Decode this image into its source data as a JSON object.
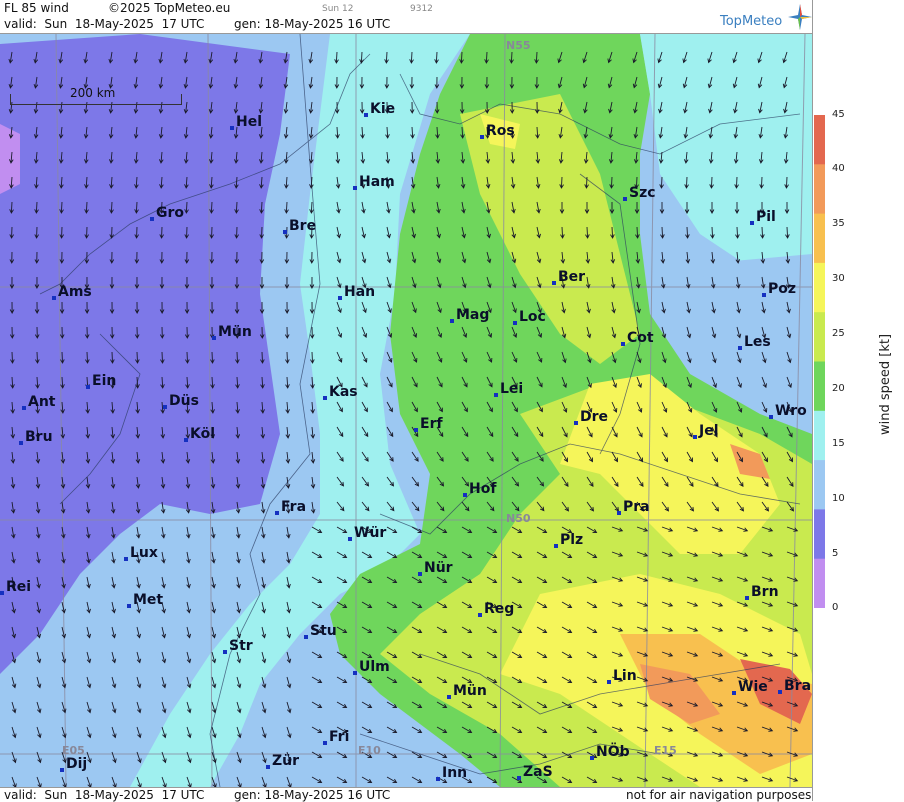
{
  "header": {
    "product": "FL 85 wind",
    "copyright": "©2025 TopMeteo.eu",
    "run_small": "Sun 12",
    "id_small": "9312",
    "valid": "valid:  Sun  18-May-2025  17 UTC",
    "gen": "gen: 18-May-2025 16 UTC",
    "logo_text": "TopMeteo"
  },
  "footer": {
    "valid": "valid:  Sun  18-May-2025  17 UTC",
    "gen": "gen: 18-May-2025 16 UTC",
    "disclaimer": "not for air navigation purposes"
  },
  "scale": {
    "label": "200 km"
  },
  "legend": {
    "title": "wind speed  [kt]",
    "ticks": [
      "45",
      "40",
      "35",
      "30",
      "25",
      "20",
      "15",
      "10",
      "5",
      "0"
    ],
    "colors": [
      "#e3684f",
      "#f29a5a",
      "#f8c04f",
      "#f5f55a",
      "#c9ea4f",
      "#6fd65c",
      "#9ff0ef",
      "#9cc8f2",
      "#7d78e8",
      "#c18ef0"
    ]
  },
  "grid_labels": [
    "N55",
    "N50",
    "E05",
    "E10",
    "E15"
  ],
  "cities": [
    {
      "name": "Kie"
    },
    {
      "name": "Hel"
    },
    {
      "name": "Ros"
    },
    {
      "name": "Ham"
    },
    {
      "name": "Szc"
    },
    {
      "name": "Gro"
    },
    {
      "name": "Bre"
    },
    {
      "name": "Pil"
    },
    {
      "name": "Ber"
    },
    {
      "name": "Ams"
    },
    {
      "name": "Han"
    },
    {
      "name": "Poz"
    },
    {
      "name": "Mag"
    },
    {
      "name": "Loc"
    },
    {
      "name": "Mün"
    },
    {
      "name": "Cot"
    },
    {
      "name": "Les"
    },
    {
      "name": "Ein"
    },
    {
      "name": "Kas"
    },
    {
      "name": "Lei"
    },
    {
      "name": "Ant"
    },
    {
      "name": "Düs"
    },
    {
      "name": "Wro"
    },
    {
      "name": "Dre"
    },
    {
      "name": "Erf"
    },
    {
      "name": "Jel"
    },
    {
      "name": "Köl"
    },
    {
      "name": "Bru"
    },
    {
      "name": "Hof"
    },
    {
      "name": "Fra"
    },
    {
      "name": "Pra"
    },
    {
      "name": "Wür"
    },
    {
      "name": "Plz"
    },
    {
      "name": "Lux"
    },
    {
      "name": "Nür"
    },
    {
      "name": "Rei"
    },
    {
      "name": "Met"
    },
    {
      "name": "Brn"
    },
    {
      "name": "Reg"
    },
    {
      "name": "Stu"
    },
    {
      "name": "Str"
    },
    {
      "name": "Ulm"
    },
    {
      "name": "Lin"
    },
    {
      "name": "Wie"
    },
    {
      "name": "Bra"
    },
    {
      "name": "Mün"
    },
    {
      "name": "Fri"
    },
    {
      "name": "Dij"
    },
    {
      "name": "Zür"
    },
    {
      "name": "NÖb"
    },
    {
      "name": "Inn"
    },
    {
      "name": "ZaS"
    }
  ]
}
